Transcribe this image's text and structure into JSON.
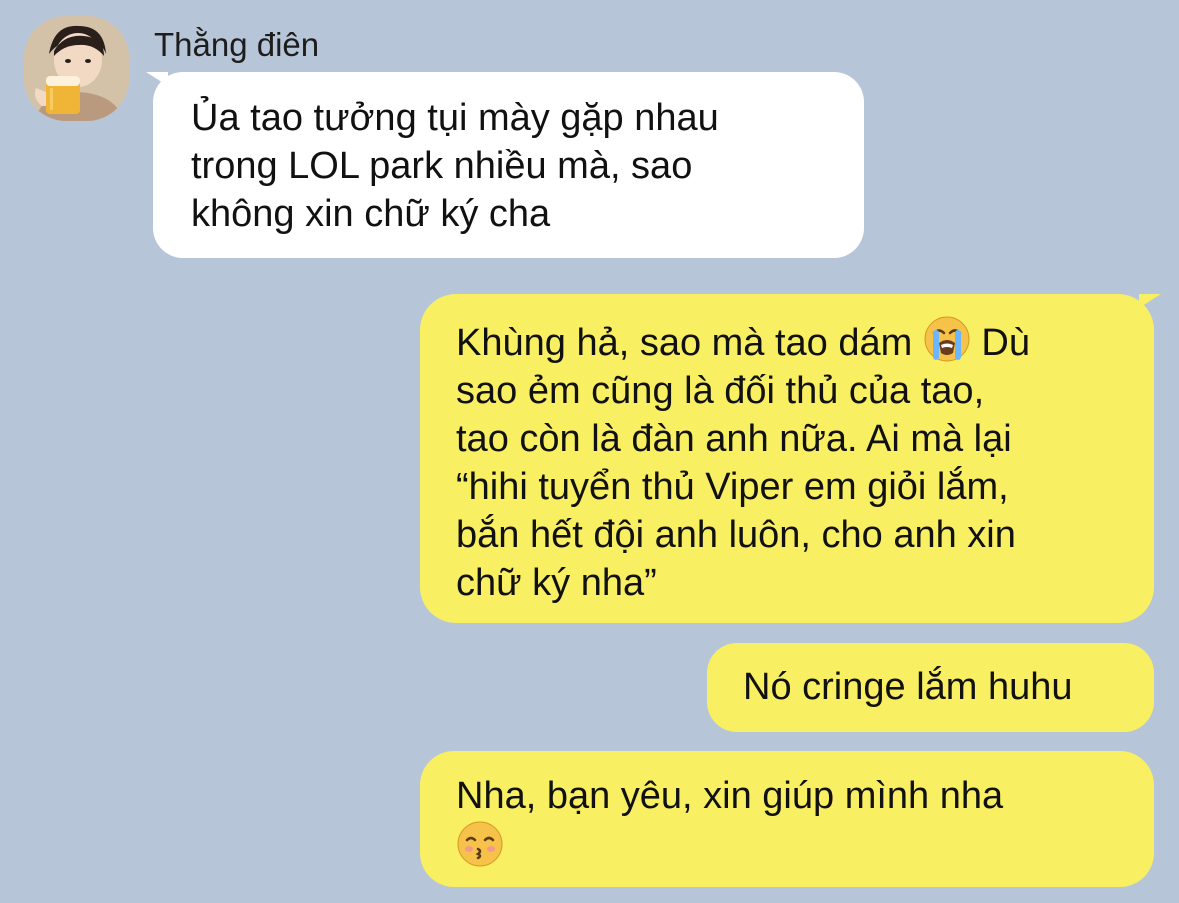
{
  "chat": {
    "contact_name": "Thằng điên",
    "messages": [
      {
        "direction": "incoming",
        "lines": [
          "Ủa tao tưởng tụi mày gặp nhau",
          "trong LOL park nhiều mà, sao",
          "không xin chữ ký cha"
        ]
      },
      {
        "direction": "outgoing",
        "lines": [
          "Khùng hả, sao mà tao dám",
          "Dù",
          "sao ẻm cũng là đối thủ của tao,",
          "tao còn là đàn anh nữa. Ai mà lại",
          "“hihi tuyển thủ Viper em giỏi lắm,",
          "bắn hết đội anh luôn, cho anh xin",
          "chữ ký nha”"
        ],
        "emoji": "loudly-crying-face"
      },
      {
        "direction": "outgoing",
        "lines": [
          "Nó cringe lắm huhu"
        ]
      },
      {
        "direction": "outgoing",
        "lines": [
          "Nha, bạn yêu, xin giúp mình nha"
        ],
        "emoji": "kissing-face-with-closed-eyes"
      }
    ]
  },
  "colors": {
    "background": "#b7c5d8",
    "incoming_bubble": "#ffffff",
    "outgoing_bubble": "#f9ef62",
    "text": "#111111"
  }
}
